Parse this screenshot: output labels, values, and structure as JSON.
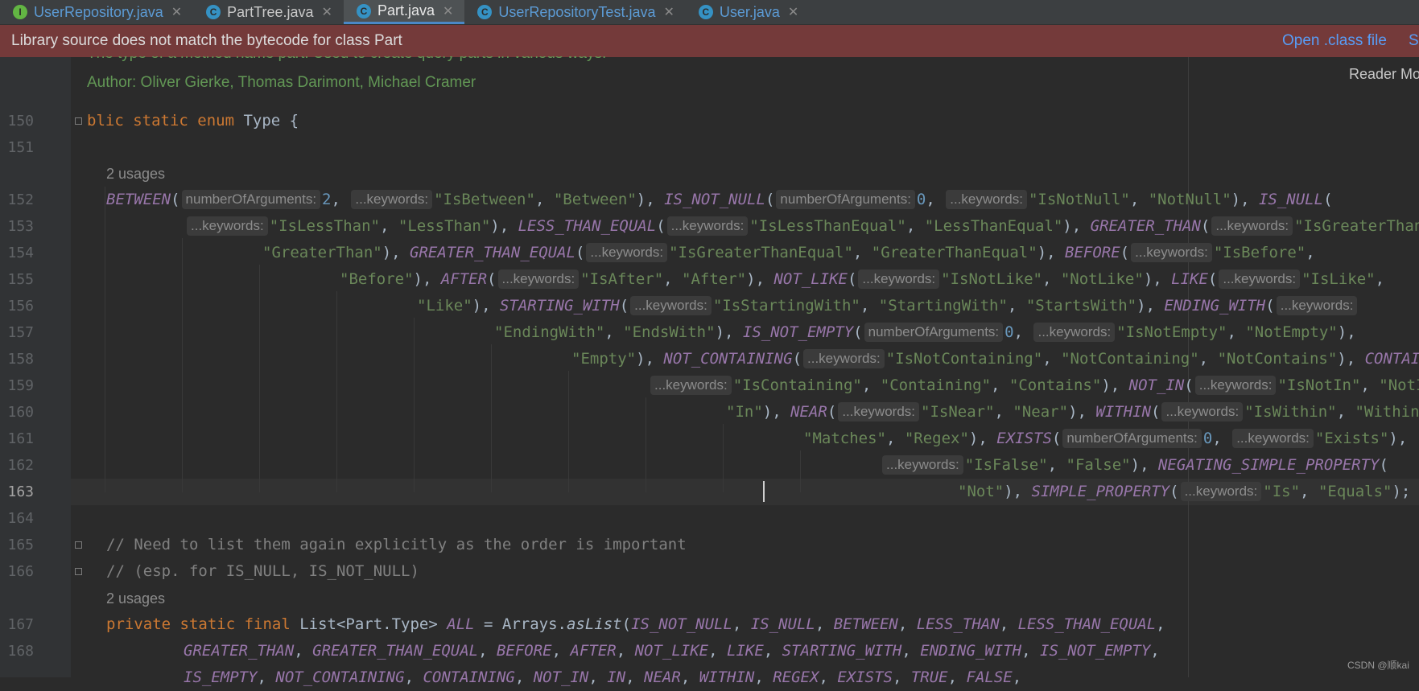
{
  "tabs": [
    {
      "label": "UserRepository.java",
      "icon": "interface-icon",
      "letter": "I"
    },
    {
      "label": "PartTree.java",
      "icon": "class-icon",
      "letter": "C"
    },
    {
      "label": "Part.java",
      "icon": "class-icon",
      "letter": "C"
    },
    {
      "label": "UserRepositoryTest.java",
      "icon": "class-icon",
      "letter": "C"
    },
    {
      "label": "User.java",
      "icon": "class-icon",
      "letter": "C"
    }
  ],
  "banner": {
    "message": "Library source does not match the bytecode for class Part",
    "open_link": "Open .class file",
    "show_link": "Sh"
  },
  "reader_mode": "Reader Mo",
  "doc": {
    "line1": "The type of a method name part. Used to create query parts in various ways.",
    "author": "Author: Oliver Gierke, Thomas Darimont, Michael Cramer"
  },
  "usages_label": "2 usages",
  "line_numbers": [
    "150",
    "151",
    "152",
    "153",
    "154",
    "155",
    "156",
    "157",
    "158",
    "159",
    "160",
    "161",
    "162",
    "163",
    "164",
    "165",
    "166",
    "167",
    "168"
  ],
  "code": {
    "l150": {
      "kw1": "blic static enum ",
      "rest": "Type {"
    },
    "l165": "// Need to list them again explicitly as the order is important",
    "l166": "// (esp. for IS_NULL, IS_NOT_NULL)"
  },
  "hints": {
    "n_args": "numberOfArguments:",
    "keywords": "...keywords:"
  },
  "watermark": "CSDN @顺kai",
  "colors": {
    "keyword": "#cc7832",
    "enum_constant": "#9876aa",
    "string": "#6a8759",
    "number": "#6897bb",
    "comment": "#808080",
    "banner": "#743a3a"
  }
}
